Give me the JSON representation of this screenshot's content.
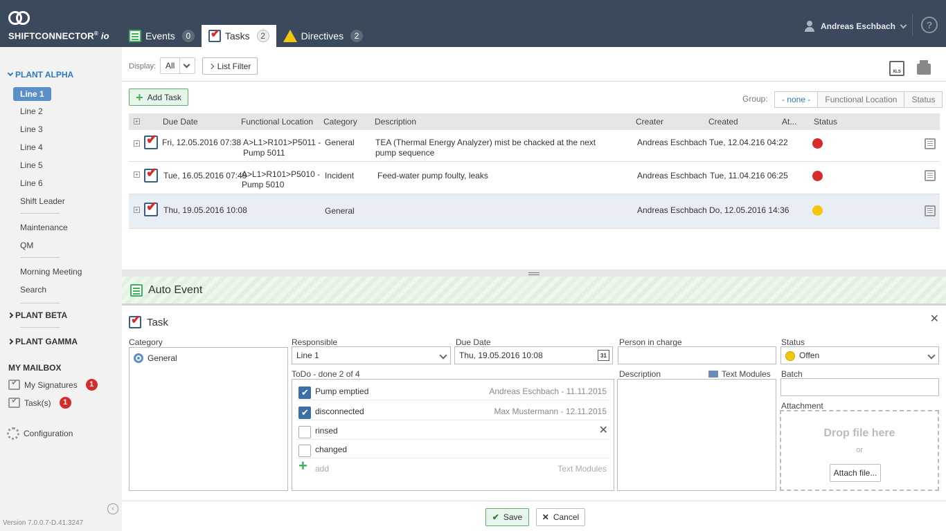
{
  "app": {
    "logo_text": "SHIFTCONNECTOR",
    "logo_suffix": "io",
    "logo_reg": "®"
  },
  "tabs": [
    {
      "label": "Events",
      "count": "0"
    },
    {
      "label": "Tasks",
      "count": "2"
    },
    {
      "label": "Directives",
      "count": "2"
    }
  ],
  "user": {
    "name": "Andreas Eschbach",
    "help": "?"
  },
  "sidebar": {
    "plant_alpha": "PLANT ALPHA",
    "lines": [
      "Line 1",
      "Line 2",
      "Line 3",
      "Line 4",
      "Line 5",
      "Line 6",
      "Shift Leader"
    ],
    "group2": [
      "Maintenance",
      "QM"
    ],
    "group3": [
      "Morning Meeting",
      "Search"
    ],
    "plant_beta": "PLANT BETA",
    "plant_gamma": "PLANT GAMMA",
    "mailbox": "MY MAILBOX",
    "my_signatures": "My Signatures",
    "my_signatures_count": "1",
    "tasks": "Task(s)",
    "tasks_count": "1",
    "configuration": "Configuration",
    "version": "Version 7.0.0.7-D.41.3247"
  },
  "toolbar": {
    "display_label": "Display:",
    "display_value": "All",
    "list_filter": "List Filter",
    "add_task": "Add Task",
    "group_label": "Group:",
    "group_options": [
      "- none -",
      "Functional Location",
      "Status"
    ],
    "xls": "XLS"
  },
  "table": {
    "headers": {
      "due_date": "Due Date",
      "functional_location": "Functional Location",
      "category": "Category",
      "description": "Description",
      "creater": "Creater",
      "created": "Created",
      "at": "At...",
      "status": "Status"
    },
    "rows": [
      {
        "due": "Fri, 12.05.2016 07:38",
        "loc1": "A>L1>R101>P5011 -",
        "loc2": "Pump 5011",
        "category": "General",
        "desc1": "TEA (Thermal Energy Analyzer) mist be chacked at the next",
        "desc2": "pump sequence",
        "creater": "Andreas Eschbach",
        "created": "Tue, 12.04.216 04:22",
        "status_color": "#d62b2b"
      },
      {
        "due": "Tue, 16.05.2016 07:49",
        "loc1": "A>L1>R101>P5010 -",
        "loc2": "Pump 5010",
        "category": "Incident",
        "desc1": "Feed-water pump foulty, leaks",
        "desc2": "",
        "creater": "Andreas Eschbach",
        "created": "Tue, 11.04.216 06:25",
        "status_color": "#d62b2b"
      },
      {
        "due": "Thu, 19.05.2016 10:08",
        "loc1": "",
        "loc2": "",
        "category": "General",
        "desc1": "",
        "desc2": "",
        "creater": "Andreas Eschbach",
        "created": "Do, 12.05.2016 14:36",
        "status_color": "#f2c80f"
      }
    ]
  },
  "auto_event": {
    "title": "Auto Event"
  },
  "detail": {
    "title": "Task",
    "category_label": "Category",
    "category_value": "General",
    "responsible_label": "Responsible",
    "responsible_value": "Line 1",
    "due_label": "Due Date",
    "due_value": "Thu, 19.05.2016 10:08",
    "calendar_day": "31",
    "person_label": "Person in charge",
    "status_label": "Status",
    "status_value": "Offen",
    "todo_label": "ToDo - done 2 of 4",
    "todos": [
      {
        "text": "Pump emptied",
        "by": "Andreas Eschbach  -  11.11.2015",
        "checked": true
      },
      {
        "text": "disconnected",
        "by": "Max Mustermann  -  12.11.2015",
        "checked": true
      },
      {
        "text": "rinsed",
        "by": "",
        "checked": false
      },
      {
        "text": "changed",
        "by": "",
        "checked": false
      }
    ],
    "add_label": "add",
    "text_modules": "Text Modules",
    "description_label": "Description",
    "batch_label": "Batch",
    "attachment_label": "Attachment",
    "drop_text": "Drop file here",
    "or_text": "or",
    "attach_button": "Attach file..."
  },
  "footer": {
    "save": "Save",
    "cancel": "Cancel"
  }
}
